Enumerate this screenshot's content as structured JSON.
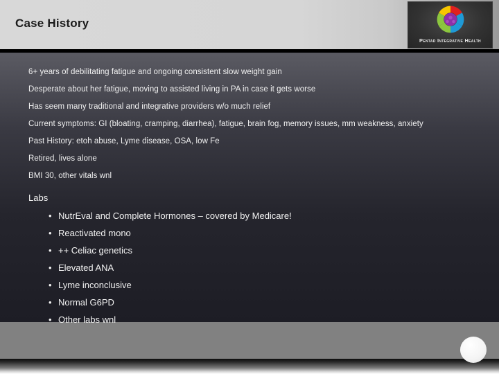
{
  "slide": {
    "title": "Case History",
    "logo": {
      "name": "pentad-integrative-health-logo",
      "text": "Pentad Integrative Health",
      "ring_colors": [
        "#e02020",
        "#8cc63f",
        "#f7c600",
        "#1f9ad6",
        "#8e2fa8"
      ],
      "center_color": "#8e2fa8"
    },
    "paragraphs": [
      "6+ years of debilitating fatigue and ongoing consistent slow weight gain",
      "Desperate about her fatigue, moving to assisted living in PA in case it gets worse",
      "Has seem many traditional and integrative providers w/o much relief",
      "Current symptoms: GI (bloating, cramping, diarrhea), fatigue, brain fog, memory issues, mm weakness, anxiety",
      "Past History: etoh abuse, Lyme disease, OSA, low Fe",
      "Retired, lives alone",
      "BMI 30, other vitals wnl"
    ],
    "labs": {
      "heading": "Labs",
      "bullet_glyph": "•",
      "items": [
        "NutrEval and Complete Hormones – covered by Medicare!",
        "Reactivated mono",
        "++ Celiac genetics",
        "Elevated ANA",
        "Lyme inconclusive",
        "Normal G6PD",
        "Other labs wnl"
      ]
    },
    "colors": {
      "header_background": "#d8d8d8",
      "header_rule": "#000000",
      "title_text": "#1a1a1a",
      "body_background_top": "#5b5b63",
      "body_background_bottom": "#1d1d25",
      "body_text": "#f2f2f2",
      "gray_band": "#818181",
      "circle": "#f4f4f4"
    }
  }
}
